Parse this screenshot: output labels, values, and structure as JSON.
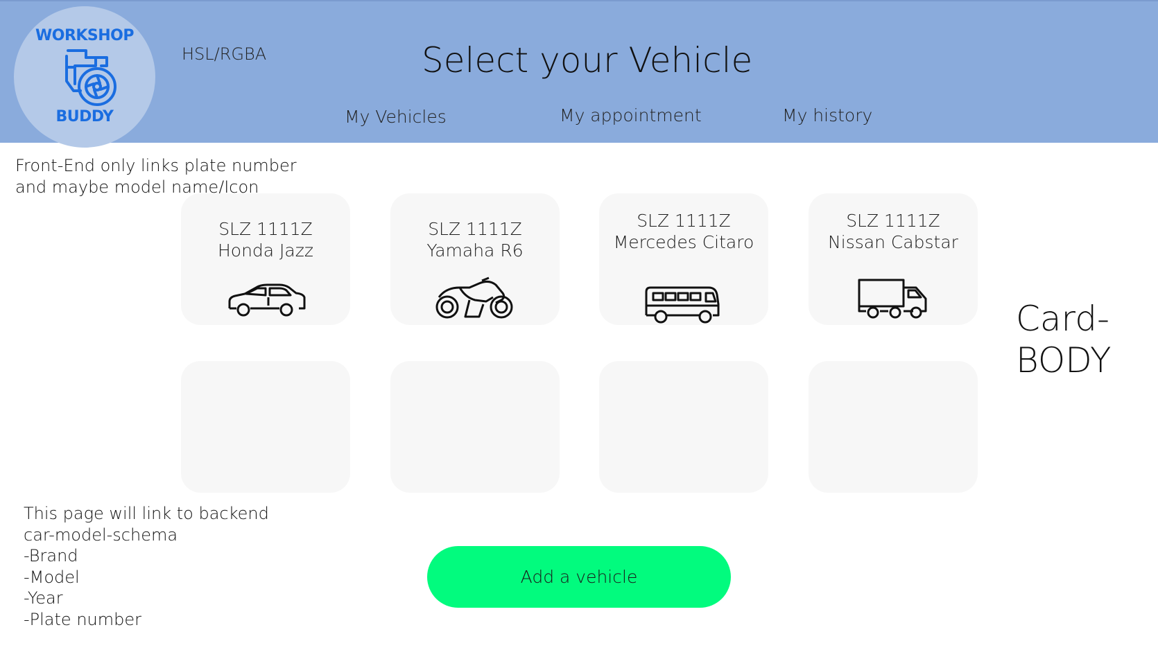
{
  "header": {
    "logo_top": "WORKSHOP",
    "logo_bottom": "BUDDY",
    "hsl_label": "HSL/RGBA",
    "title": "Select your Vehicle",
    "nav": {
      "vehicles": "My Vehicles",
      "appointment": "My appointment",
      "history": "My history"
    }
  },
  "notes": {
    "frontend": [
      "Front-End only links plate number",
      "and maybe model name/Icon"
    ],
    "backend": [
      "This page  will link to backend",
      "car-model-schema",
      "-Brand",
      "-Model",
      "-Year",
      "-Plate number"
    ]
  },
  "vehicles": [
    {
      "plate": "SLZ 1111Z",
      "model": "Honda Jazz",
      "icon": "car-icon"
    },
    {
      "plate": "SLZ 1111Z",
      "model": "Yamaha R6",
      "icon": "motorcycle-icon"
    },
    {
      "plate": "SLZ 1111Z",
      "model": "Mercedes Citaro",
      "icon": "bus-icon"
    },
    {
      "plate": "SLZ 1111Z",
      "model": "Nissan Cabstar",
      "icon": "truck-icon"
    }
  ],
  "card_label": [
    "Card-",
    "BODY"
  ],
  "add_button": "Add a vehicle",
  "colors": {
    "header_bg": "#8aabdc",
    "logo_blue": "#1a6de0",
    "card_bg": "#f7f7f7",
    "button_green": "#02fb7e"
  }
}
